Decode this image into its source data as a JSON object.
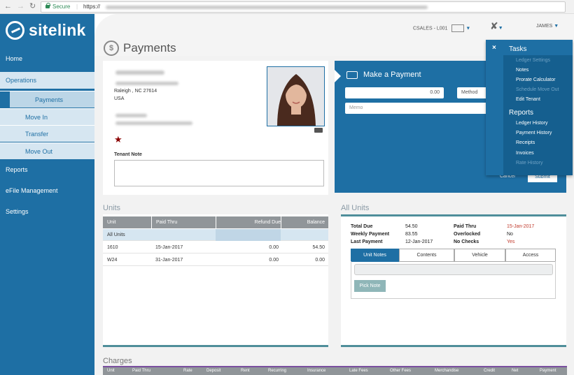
{
  "browser": {
    "secure_label": "Secure",
    "url_prefix": "https://"
  },
  "brand": {
    "name": "sitelink"
  },
  "sidebar": {
    "home": "Home",
    "operations": "Operations",
    "payments": "Payments",
    "move_in": "Move In",
    "transfer": "Transfer",
    "move_out": "Move Out",
    "reports": "Reports",
    "efile": "eFile Management",
    "settings": "Settings"
  },
  "header": {
    "site": "CSALES - L001",
    "user": "JAMES"
  },
  "page": {
    "title": "Payments"
  },
  "tenant": {
    "address_city": "Raleigh , NC 27614",
    "country": "USA",
    "note_label": "Tenant Note"
  },
  "payment": {
    "title": "Make a Payment",
    "amount": "0.00",
    "method_label": "Method",
    "memo_placeholder": "Memo",
    "cancel_label": "Cancel",
    "submit_label": "Submit"
  },
  "tasks_menu": {
    "tasks_heading": "Tasks",
    "tasks": [
      {
        "label": "Ledger Settings",
        "enabled": false
      },
      {
        "label": "Notes",
        "enabled": true
      },
      {
        "label": "Prorate Calculator",
        "enabled": true
      },
      {
        "label": "Schedule Move Out",
        "enabled": false
      },
      {
        "label": "Edit Tenant",
        "enabled": true
      }
    ],
    "reports_heading": "Reports",
    "reports": [
      {
        "label": "Ledger History",
        "enabled": true
      },
      {
        "label": "Payment History",
        "enabled": true
      },
      {
        "label": "Receipts",
        "enabled": true
      },
      {
        "label": "Invoices",
        "enabled": true
      },
      {
        "label": "Rate History",
        "enabled": false
      }
    ]
  },
  "units": {
    "title": "Units",
    "columns": [
      "Unit",
      "Paid Thru",
      "Refund Due",
      "Balance"
    ],
    "all_units_label": "All Units",
    "rows": [
      {
        "unit": "1610",
        "paid_thru": "15-Jan-2017",
        "refund_due": "0.00",
        "balance": "54.50"
      },
      {
        "unit": "W24",
        "paid_thru": "31-Jan-2017",
        "refund_due": "0.00",
        "balance": "0.00"
      }
    ]
  },
  "all_units": {
    "title": "All Units",
    "total_due_label": "Total Due",
    "total_due": "54.50",
    "weekly_payment_label": "Weekly Payment",
    "weekly_payment": "83.55",
    "last_payment_label": "Last Payment",
    "last_payment": "12-Jan-2017",
    "paid_thru_label": "Paid Thru",
    "paid_thru": "15-Jan-2017",
    "overlocked_label": "Overlocked",
    "overlocked": "No",
    "no_checks_label": "No Checks",
    "no_checks": "Yes",
    "tabs": [
      "Unit Notes",
      "Contents",
      "Vehicle",
      "Access"
    ],
    "pick_note_label": "Pick Note"
  },
  "charges": {
    "title": "Charges",
    "columns": [
      "Unit",
      "Paid Thru",
      "Rate",
      "Deposit",
      "Rent",
      "Recurring",
      "Insurance",
      "Late Fees",
      "Other Fees",
      "Merchandise",
      "Credit",
      "Net",
      "Payment"
    ]
  },
  "colors": {
    "brand": "#1e6fa4",
    "alert": "#c0392b"
  }
}
